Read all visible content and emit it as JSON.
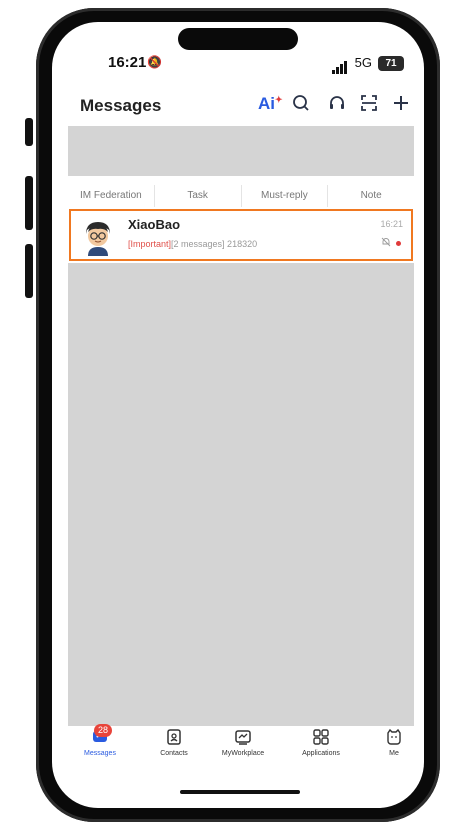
{
  "status": {
    "time": "16:21",
    "network": "5G",
    "battery": "71"
  },
  "header": {
    "title": "Messages",
    "ai_label": "Ai"
  },
  "tabs": [
    "IM Federation",
    "Task",
    "Must-reply",
    "Note"
  ],
  "conversation": {
    "name": "XiaoBao",
    "tag": "[Important]",
    "preview": "[2 messages] 218320",
    "time": "16:21"
  },
  "tabbar": {
    "items": [
      {
        "label": "Messages",
        "icon": "chat-icon",
        "badge": "28"
      },
      {
        "label": "Contacts",
        "icon": "contacts-icon"
      },
      {
        "label": "MyWorkplace",
        "icon": "workplace-icon"
      },
      {
        "label": "Applications",
        "icon": "applications-grid-icon"
      },
      {
        "label": "Me",
        "icon": "me-cat-icon"
      }
    ]
  },
  "colors": {
    "accent": "#2a5be0",
    "highlight": "#f07820",
    "important": "#e0504a",
    "badge": "#e8443a"
  }
}
